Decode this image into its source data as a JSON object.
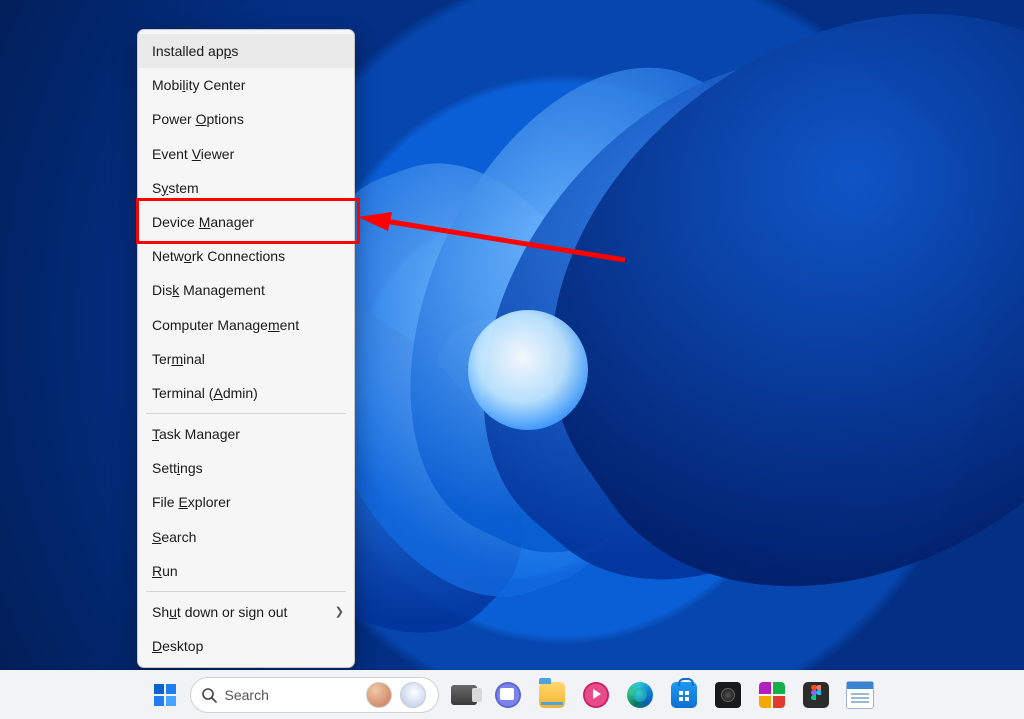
{
  "menu": {
    "items": [
      {
        "label": "Installed apps",
        "u": 12,
        "highlighted": true
      },
      {
        "label": "Mobility Center",
        "u": 4
      },
      {
        "label": "Power Options",
        "u": 6
      },
      {
        "label": "Event Viewer",
        "u": 6
      },
      {
        "label": "System",
        "u": 1
      },
      {
        "label": "Device Manager",
        "u": 7,
        "boxed": true
      },
      {
        "label": "Network Connections",
        "u": 4
      },
      {
        "label": "Disk Management",
        "u": 3
      },
      {
        "label": "Computer Management",
        "u": 15
      },
      {
        "label": "Terminal",
        "u": 3
      },
      {
        "label": "Terminal (Admin)",
        "u": 10
      },
      {
        "sep": true
      },
      {
        "label": "Task Manager",
        "u": 0
      },
      {
        "label": "Settings",
        "u": 4
      },
      {
        "label": "File Explorer",
        "u": 5
      },
      {
        "label": "Search",
        "u": 0
      },
      {
        "label": "Run",
        "u": 0
      },
      {
        "sep": true
      },
      {
        "label": "Shut down or sign out",
        "u": 2,
        "submenu": true
      },
      {
        "label": "Desktop",
        "u": 0
      }
    ]
  },
  "annotation": {
    "highlight_target": "Device Manager",
    "arrow_color": "#ff0000"
  },
  "taskbar": {
    "search_placeholder": "Search",
    "icons": [
      {
        "name": "start-button"
      },
      {
        "name": "search-pill"
      },
      {
        "name": "task-view-button"
      },
      {
        "name": "teams-chat"
      },
      {
        "name": "file-explorer"
      },
      {
        "name": "springboard-app"
      },
      {
        "name": "microsoft-edge"
      },
      {
        "name": "microsoft-store"
      },
      {
        "name": "camera-app"
      },
      {
        "name": "powertoys"
      },
      {
        "name": "figma"
      },
      {
        "name": "notepad"
      }
    ]
  }
}
